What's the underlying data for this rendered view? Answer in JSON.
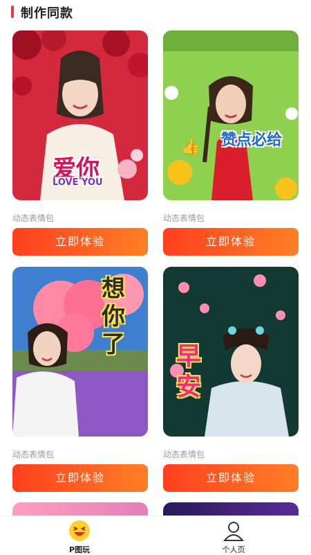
{
  "header": {
    "title": "制作同款"
  },
  "cards": [
    {
      "caption": "动态表情包",
      "button": "立即体验",
      "overlay": "爱你",
      "overlay_sub": "LOVE YOU"
    },
    {
      "caption": "动态表情包",
      "button": "立即体验",
      "overlay": "赞点必给"
    },
    {
      "caption": "动态表情包",
      "button": "立即体验",
      "overlay": "想你了"
    },
    {
      "caption": "动态表情包",
      "button": "立即体验",
      "overlay": "早安"
    }
  ],
  "tabbar": {
    "tabs": [
      {
        "label": "P图玩",
        "icon": "laughing-face-icon",
        "active": true
      },
      {
        "label": "个人页",
        "icon": "person-icon",
        "active": false
      }
    ]
  },
  "colors": {
    "accent": "#ff5a23",
    "header_bar": "#e8354b"
  }
}
